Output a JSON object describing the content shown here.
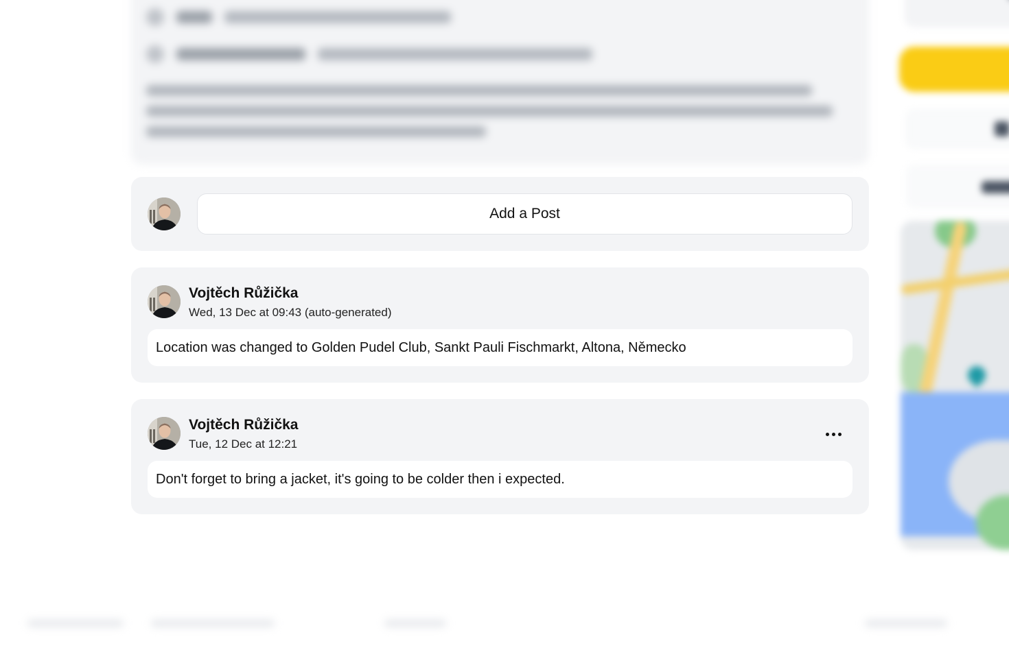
{
  "composer": {
    "add_post_label": "Add a Post"
  },
  "posts": [
    {
      "author": "Vojtěch Růžička",
      "timestamp": "Wed, 13 Dec at 09:43 (auto-generated)",
      "body": "Location was changed to Golden Pudel Club, Sankt Pauli Fischmarkt, Altona, Německo",
      "has_menu": false
    },
    {
      "author": "Vojtěch Růžička",
      "timestamp": "Tue, 12 Dec at 12:21",
      "body": "Don't forget to bring a jacket, it's going to be colder then i expected.",
      "has_menu": true
    }
  ],
  "icons": {
    "post_menu": "more-horizontal-icon",
    "user_avatar": "user-avatar-photo"
  },
  "colors": {
    "card_background": "#f3f4f6",
    "accent_yellow": "#facc15",
    "text_primary": "#111111"
  }
}
